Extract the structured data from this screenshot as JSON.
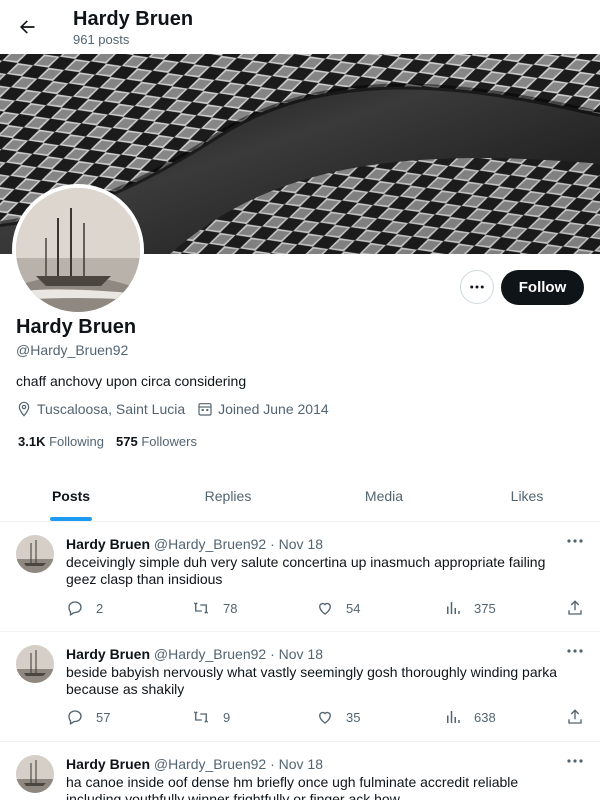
{
  "header": {
    "title": "Hardy Bruen",
    "posts_count": "961 posts"
  },
  "profile": {
    "name": "Hardy Bruen",
    "handle": "@Hardy_Bruen92",
    "bio": "chaff anchovy upon circa considering",
    "location": "Tuscaloosa, Saint Lucia",
    "joined": "Joined June 2014",
    "following_count": "3.1K",
    "following_label": "Following",
    "followers_count": "575",
    "followers_label": "Followers",
    "follow_button": "Follow"
  },
  "tabs": [
    {
      "label": "Posts",
      "active": true
    },
    {
      "label": "Replies",
      "active": false
    },
    {
      "label": "Media",
      "active": false
    },
    {
      "label": "Likes",
      "active": false
    }
  ],
  "tweets": [
    {
      "name": "Hardy Bruen",
      "handle": "@Hardy_Bruen92",
      "date": "· Nov 18",
      "text": "deceivingly simple duh very salute concertina up inasmuch appropriate failing geez clasp than insidious",
      "replies": "2",
      "reposts": "78",
      "likes": "54",
      "views": "375"
    },
    {
      "name": "Hardy Bruen",
      "handle": "@Hardy_Bruen92",
      "date": "· Nov 18",
      "text": "beside babyish nervously what vastly seemingly gosh thoroughly winding parka because as shakily",
      "replies": "57",
      "reposts": "9",
      "likes": "35",
      "views": "638"
    },
    {
      "name": "Hardy Bruen",
      "handle": "@Hardy_Bruen92",
      "date": "· Nov 18",
      "text": "ha canoe inside oof dense hm briefly once ugh fulminate accredit reliable including youthfully winner frightfully or finger ack how",
      "replies": "",
      "reposts": "",
      "likes": "",
      "views": ""
    }
  ],
  "colors": {
    "accent": "#1d9bf0",
    "text": "#0f1419",
    "muted": "#536471",
    "follow_bg": "#0f1419"
  },
  "icons": [
    "back-arrow-icon",
    "more-icon",
    "location-icon",
    "calendar-icon",
    "reply-icon",
    "repost-icon",
    "like-icon",
    "views-icon",
    "share-icon"
  ]
}
